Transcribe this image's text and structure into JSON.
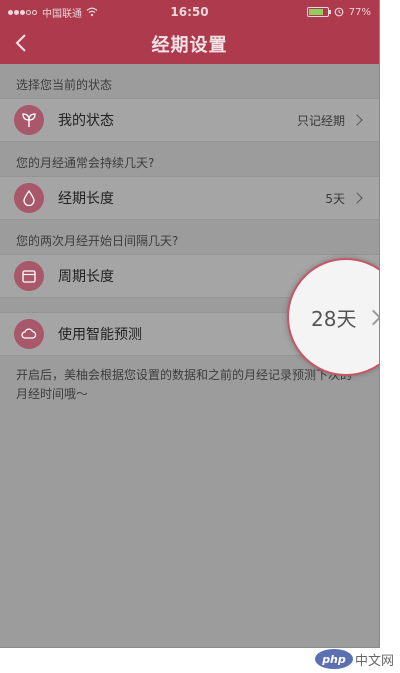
{
  "status_bar": {
    "carrier": "中国联通",
    "time": "16:50",
    "battery_text": "77%",
    "battery_level": 0.77
  },
  "nav": {
    "back_icon": "chevron-left-icon",
    "title": "经期设置"
  },
  "sections": [
    {
      "header": "选择您当前的状态",
      "row": {
        "label": "我的状态",
        "value": "只记经期",
        "icon": "sprout-icon"
      }
    },
    {
      "header": "您的月经通常会持续几天?",
      "row": {
        "label": "经期长度",
        "value": "5天",
        "icon": "droplet-icon"
      }
    },
    {
      "header": "您的两次月经开始日间隔几天?",
      "row": {
        "label": "周期长度",
        "value": "28天",
        "icon": "calendar-icon"
      }
    }
  ],
  "smart_predict": {
    "label": "使用智能预测",
    "icon": "cloud-icon",
    "enabled": false,
    "description": "开启后，美柚会根据您设置的数据和之前的月经记录预测下次的月经时间哦～"
  },
  "magnifier": {
    "value": "28天"
  },
  "watermark": {
    "logo_text": "php",
    "site": "中文网"
  },
  "colors": {
    "brand": "#ad3a4d",
    "icon_bg": "#a8586a",
    "overlay_bg": "#9c9c9c",
    "magnifier_border": "#c85567"
  }
}
